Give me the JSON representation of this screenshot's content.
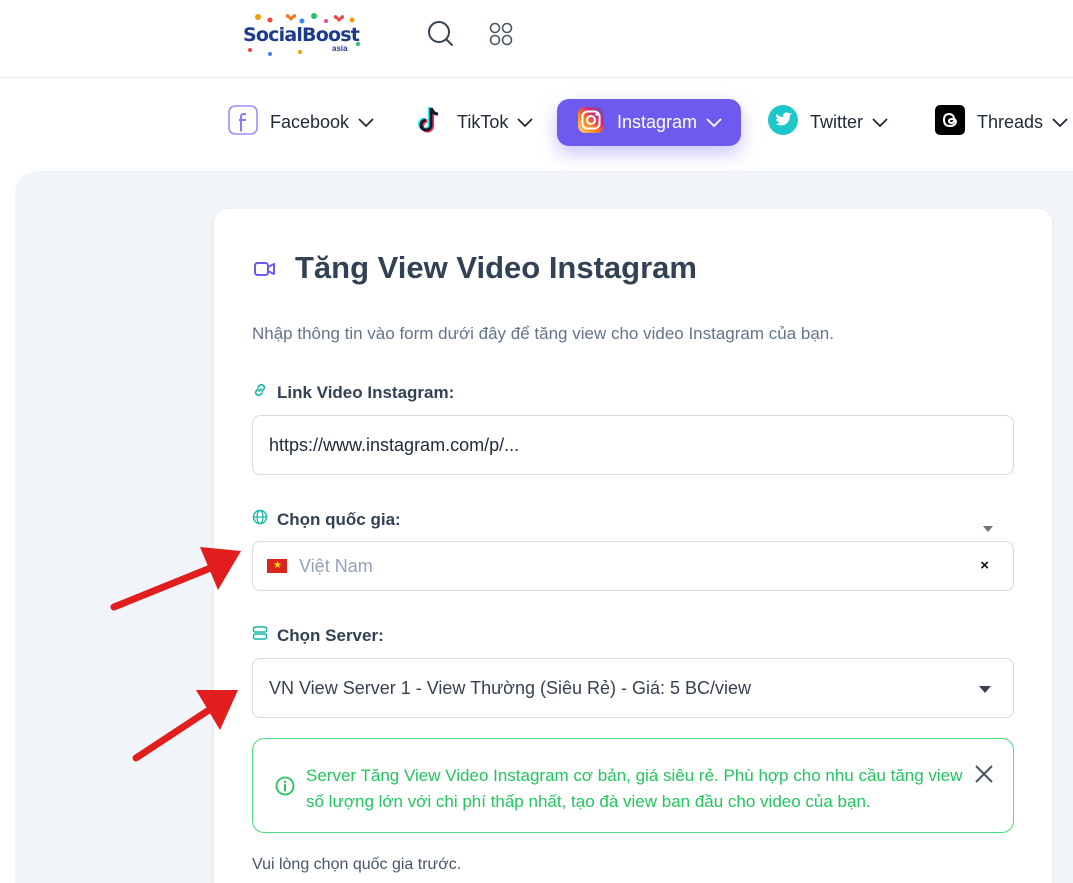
{
  "header": {
    "logo_text": "SocialBoost",
    "logo_sub": "asia",
    "search_icon": "search-icon",
    "apps_icon": "apps-grid-icon"
  },
  "nav": {
    "items": [
      {
        "label": "Facebook",
        "icon": "facebook-icon",
        "active": false
      },
      {
        "label": "TikTok",
        "icon": "tiktok-icon",
        "active": false
      },
      {
        "label": "Instagram",
        "icon": "instagram-icon",
        "active": true
      },
      {
        "label": "Twitter",
        "icon": "twitter-icon",
        "active": false
      },
      {
        "label": "Threads",
        "icon": "threads-icon",
        "active": false
      }
    ]
  },
  "form": {
    "title": "Tăng View Video Instagram",
    "description": "Nhập thông tin vào form dưới đây để tăng view cho video Instagram của bạn.",
    "link": {
      "label": "Link Video Instagram:",
      "placeholder": "https://www.instagram.com/p/..."
    },
    "country": {
      "label": "Chọn quốc gia:",
      "value": "Việt Nam",
      "clear": "×"
    },
    "server": {
      "label": "Chọn Server:",
      "value": "VN View Server 1 - View Thường (Siêu Rẻ) - Giá: 5 BC/view"
    },
    "alert": {
      "message": "Server Tăng View Video Instagram cơ bản, giá siêu rẻ. Phù hợp cho nhu cầu tăng view số lượng lớn với chi phí thấp nhất, tạo đà view ban đầu cho video của bạn."
    },
    "hint": "Vui lòng chọn quốc gia trước."
  },
  "colors": {
    "accent": "#6d5bf0",
    "success": "#22c55e",
    "arrow": "#e11d1d"
  }
}
